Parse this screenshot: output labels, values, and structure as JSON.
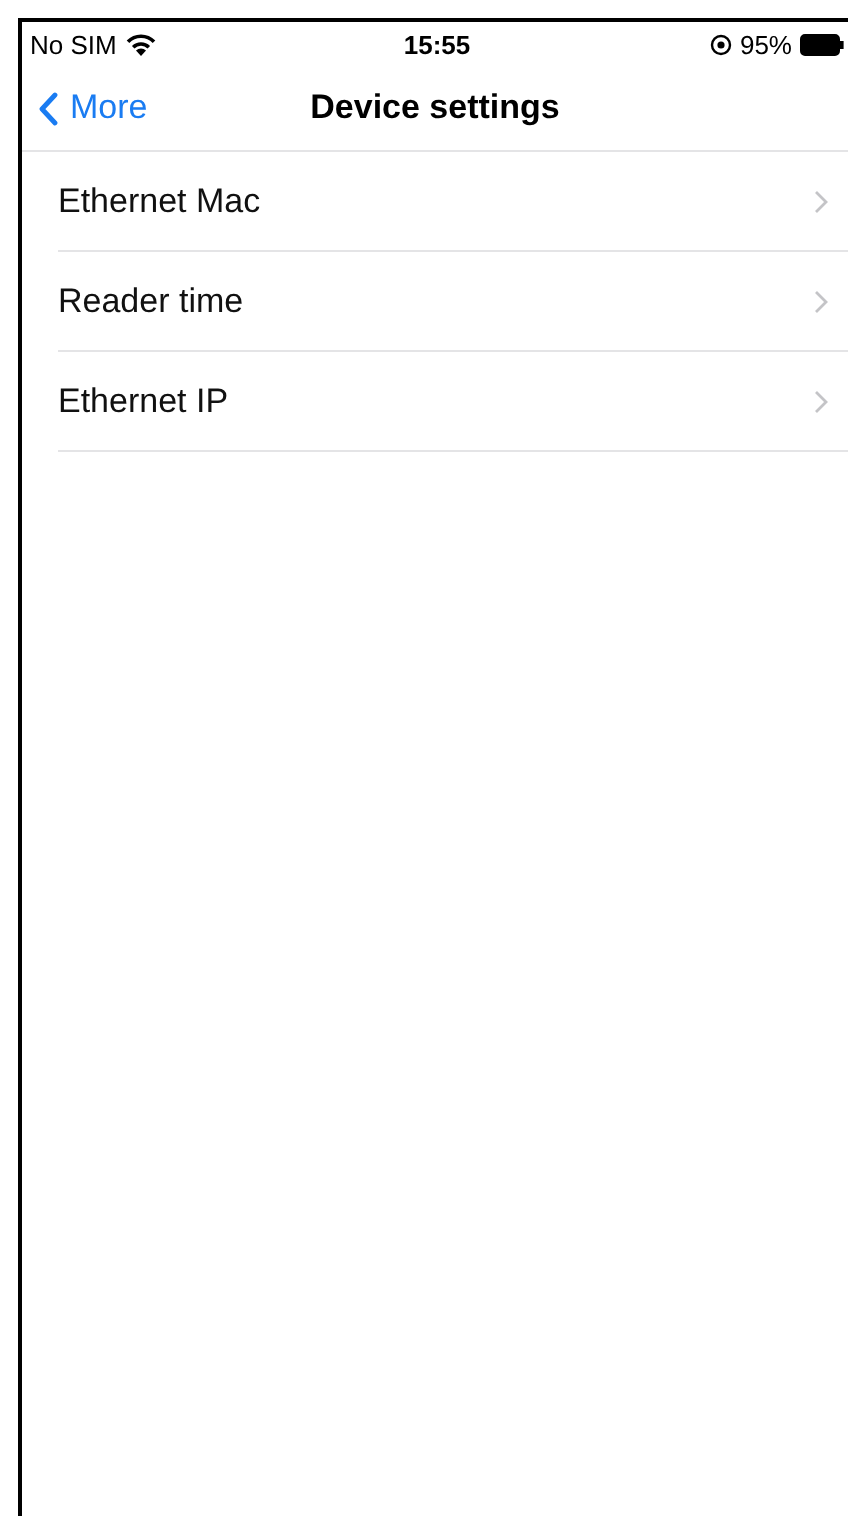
{
  "status_bar": {
    "carrier": "No SIM",
    "time": "15:55",
    "battery": "95%"
  },
  "nav": {
    "back": "More",
    "title": "Device settings"
  },
  "items": [
    {
      "label": "Ethernet Mac"
    },
    {
      "label": "Reader time"
    },
    {
      "label": "Ethernet IP"
    }
  ]
}
